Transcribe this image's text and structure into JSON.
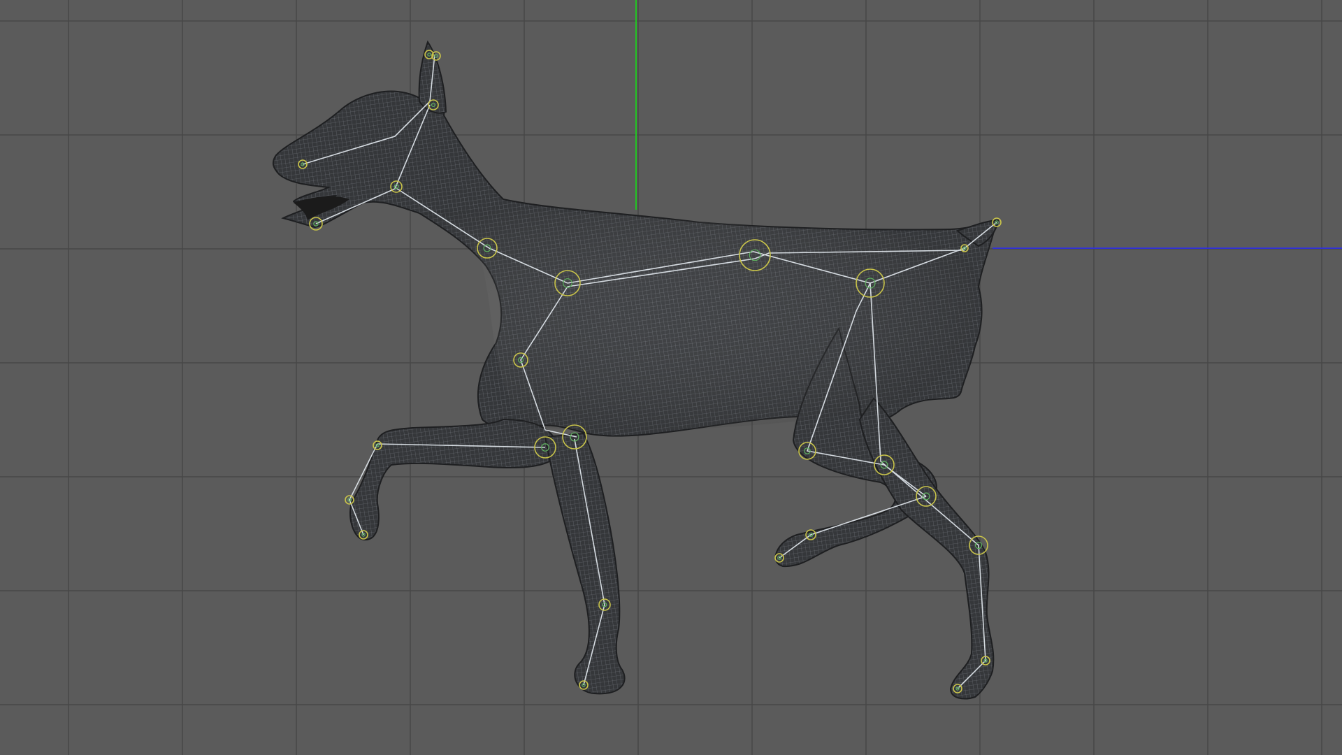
{
  "viewport": {
    "background": "#5b5b5b",
    "grid_color": "#474747",
    "axis_y_color": "#22c322",
    "axis_x_color": "#2a2aff"
  },
  "model": {
    "mesh_fill": "#3b3d40",
    "mesh_line": "#9aa0a8",
    "bone_color": "#e6ecf2",
    "joint_outer_color": "#c9c44a",
    "joint_inner_color": "#5fb25f"
  }
}
